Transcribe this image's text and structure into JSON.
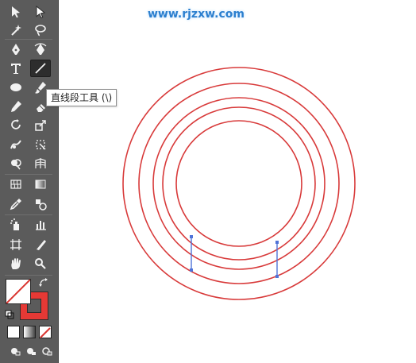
{
  "watermark": {
    "text": "www.rjzxw.com"
  },
  "tooltip": {
    "text": "直线段工具 (\\)"
  },
  "toolbar": {
    "tools": [
      "selection-tool",
      "direct-selection-tool",
      "magic-wand-tool",
      "lasso-tool",
      "pen-tool",
      "curvature-tool",
      "type-tool",
      "line-segment-tool",
      "ellipse-tool",
      "paintbrush-tool",
      "pencil-tool",
      "eraser-tool",
      "rotate-tool",
      "scale-tool",
      "warp-tool",
      "free-transform-tool",
      "shape-builder-tool",
      "perspective-grid-tool",
      "mesh-tool",
      "gradient-tool",
      "eyedropper-tool",
      "blend-tool",
      "symbol-sprayer-tool",
      "column-graph-tool",
      "artboard-tool",
      "slice-tool",
      "hand-tool",
      "zoom-tool"
    ],
    "selected_tool": "line-segment-tool"
  },
  "colors": {
    "toolbar_bg": "#5b5b5b",
    "circle_stroke": "#d83a3a",
    "selection_blue": "#4f73d8",
    "stroke_swatch": "#e53935",
    "fill_swatch": "#ffffff",
    "watermark": "#2b7fcf"
  },
  "canvas": {
    "circle_count": 5,
    "selected_line_segments": 2
  }
}
